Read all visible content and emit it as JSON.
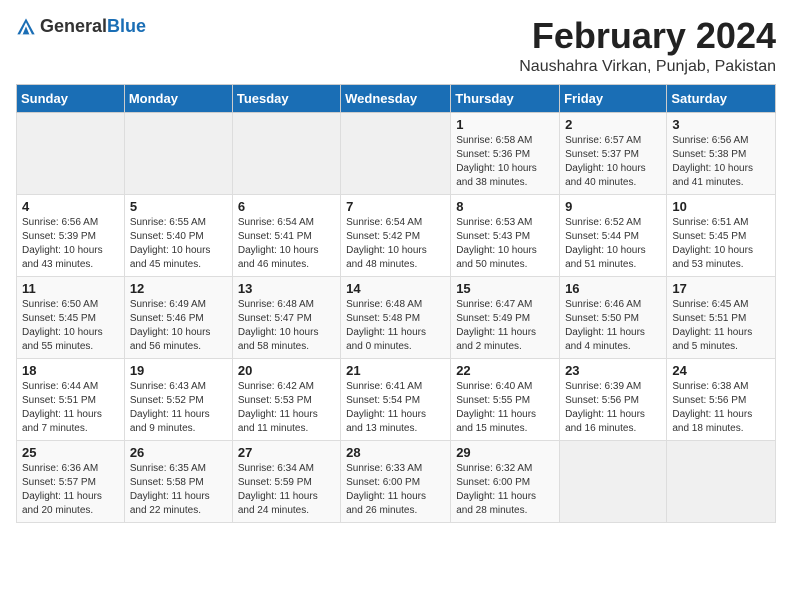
{
  "logo": {
    "general": "General",
    "blue": "Blue"
  },
  "header": {
    "month": "February 2024",
    "location": "Naushahra Virkan, Punjab, Pakistan"
  },
  "days_of_week": [
    "Sunday",
    "Monday",
    "Tuesday",
    "Wednesday",
    "Thursday",
    "Friday",
    "Saturday"
  ],
  "weeks": [
    [
      {
        "day": "",
        "sunrise": "",
        "sunset": "",
        "daylight": "",
        "empty": true
      },
      {
        "day": "",
        "sunrise": "",
        "sunset": "",
        "daylight": "",
        "empty": true
      },
      {
        "day": "",
        "sunrise": "",
        "sunset": "",
        "daylight": "",
        "empty": true
      },
      {
        "day": "",
        "sunrise": "",
        "sunset": "",
        "daylight": "",
        "empty": true
      },
      {
        "day": "1",
        "sunrise": "Sunrise: 6:58 AM",
        "sunset": "Sunset: 5:36 PM",
        "daylight": "Daylight: 10 hours and 38 minutes."
      },
      {
        "day": "2",
        "sunrise": "Sunrise: 6:57 AM",
        "sunset": "Sunset: 5:37 PM",
        "daylight": "Daylight: 10 hours and 40 minutes."
      },
      {
        "day": "3",
        "sunrise": "Sunrise: 6:56 AM",
        "sunset": "Sunset: 5:38 PM",
        "daylight": "Daylight: 10 hours and 41 minutes."
      }
    ],
    [
      {
        "day": "4",
        "sunrise": "Sunrise: 6:56 AM",
        "sunset": "Sunset: 5:39 PM",
        "daylight": "Daylight: 10 hours and 43 minutes."
      },
      {
        "day": "5",
        "sunrise": "Sunrise: 6:55 AM",
        "sunset": "Sunset: 5:40 PM",
        "daylight": "Daylight: 10 hours and 45 minutes."
      },
      {
        "day": "6",
        "sunrise": "Sunrise: 6:54 AM",
        "sunset": "Sunset: 5:41 PM",
        "daylight": "Daylight: 10 hours and 46 minutes."
      },
      {
        "day": "7",
        "sunrise": "Sunrise: 6:54 AM",
        "sunset": "Sunset: 5:42 PM",
        "daylight": "Daylight: 10 hours and 48 minutes."
      },
      {
        "day": "8",
        "sunrise": "Sunrise: 6:53 AM",
        "sunset": "Sunset: 5:43 PM",
        "daylight": "Daylight: 10 hours and 50 minutes."
      },
      {
        "day": "9",
        "sunrise": "Sunrise: 6:52 AM",
        "sunset": "Sunset: 5:44 PM",
        "daylight": "Daylight: 10 hours and 51 minutes."
      },
      {
        "day": "10",
        "sunrise": "Sunrise: 6:51 AM",
        "sunset": "Sunset: 5:45 PM",
        "daylight": "Daylight: 10 hours and 53 minutes."
      }
    ],
    [
      {
        "day": "11",
        "sunrise": "Sunrise: 6:50 AM",
        "sunset": "Sunset: 5:45 PM",
        "daylight": "Daylight: 10 hours and 55 minutes."
      },
      {
        "day": "12",
        "sunrise": "Sunrise: 6:49 AM",
        "sunset": "Sunset: 5:46 PM",
        "daylight": "Daylight: 10 hours and 56 minutes."
      },
      {
        "day": "13",
        "sunrise": "Sunrise: 6:48 AM",
        "sunset": "Sunset: 5:47 PM",
        "daylight": "Daylight: 10 hours and 58 minutes."
      },
      {
        "day": "14",
        "sunrise": "Sunrise: 6:48 AM",
        "sunset": "Sunset: 5:48 PM",
        "daylight": "Daylight: 11 hours and 0 minutes."
      },
      {
        "day": "15",
        "sunrise": "Sunrise: 6:47 AM",
        "sunset": "Sunset: 5:49 PM",
        "daylight": "Daylight: 11 hours and 2 minutes."
      },
      {
        "day": "16",
        "sunrise": "Sunrise: 6:46 AM",
        "sunset": "Sunset: 5:50 PM",
        "daylight": "Daylight: 11 hours and 4 minutes."
      },
      {
        "day": "17",
        "sunrise": "Sunrise: 6:45 AM",
        "sunset": "Sunset: 5:51 PM",
        "daylight": "Daylight: 11 hours and 5 minutes."
      }
    ],
    [
      {
        "day": "18",
        "sunrise": "Sunrise: 6:44 AM",
        "sunset": "Sunset: 5:51 PM",
        "daylight": "Daylight: 11 hours and 7 minutes."
      },
      {
        "day": "19",
        "sunrise": "Sunrise: 6:43 AM",
        "sunset": "Sunset: 5:52 PM",
        "daylight": "Daylight: 11 hours and 9 minutes."
      },
      {
        "day": "20",
        "sunrise": "Sunrise: 6:42 AM",
        "sunset": "Sunset: 5:53 PM",
        "daylight": "Daylight: 11 hours and 11 minutes."
      },
      {
        "day": "21",
        "sunrise": "Sunrise: 6:41 AM",
        "sunset": "Sunset: 5:54 PM",
        "daylight": "Daylight: 11 hours and 13 minutes."
      },
      {
        "day": "22",
        "sunrise": "Sunrise: 6:40 AM",
        "sunset": "Sunset: 5:55 PM",
        "daylight": "Daylight: 11 hours and 15 minutes."
      },
      {
        "day": "23",
        "sunrise": "Sunrise: 6:39 AM",
        "sunset": "Sunset: 5:56 PM",
        "daylight": "Daylight: 11 hours and 16 minutes."
      },
      {
        "day": "24",
        "sunrise": "Sunrise: 6:38 AM",
        "sunset": "Sunset: 5:56 PM",
        "daylight": "Daylight: 11 hours and 18 minutes."
      }
    ],
    [
      {
        "day": "25",
        "sunrise": "Sunrise: 6:36 AM",
        "sunset": "Sunset: 5:57 PM",
        "daylight": "Daylight: 11 hours and 20 minutes."
      },
      {
        "day": "26",
        "sunrise": "Sunrise: 6:35 AM",
        "sunset": "Sunset: 5:58 PM",
        "daylight": "Daylight: 11 hours and 22 minutes."
      },
      {
        "day": "27",
        "sunrise": "Sunrise: 6:34 AM",
        "sunset": "Sunset: 5:59 PM",
        "daylight": "Daylight: 11 hours and 24 minutes."
      },
      {
        "day": "28",
        "sunrise": "Sunrise: 6:33 AM",
        "sunset": "Sunset: 6:00 PM",
        "daylight": "Daylight: 11 hours and 26 minutes."
      },
      {
        "day": "29",
        "sunrise": "Sunrise: 6:32 AM",
        "sunset": "Sunset: 6:00 PM",
        "daylight": "Daylight: 11 hours and 28 minutes."
      },
      {
        "day": "",
        "sunrise": "",
        "sunset": "",
        "daylight": "",
        "empty": true
      },
      {
        "day": "",
        "sunrise": "",
        "sunset": "",
        "daylight": "",
        "empty": true
      }
    ]
  ]
}
